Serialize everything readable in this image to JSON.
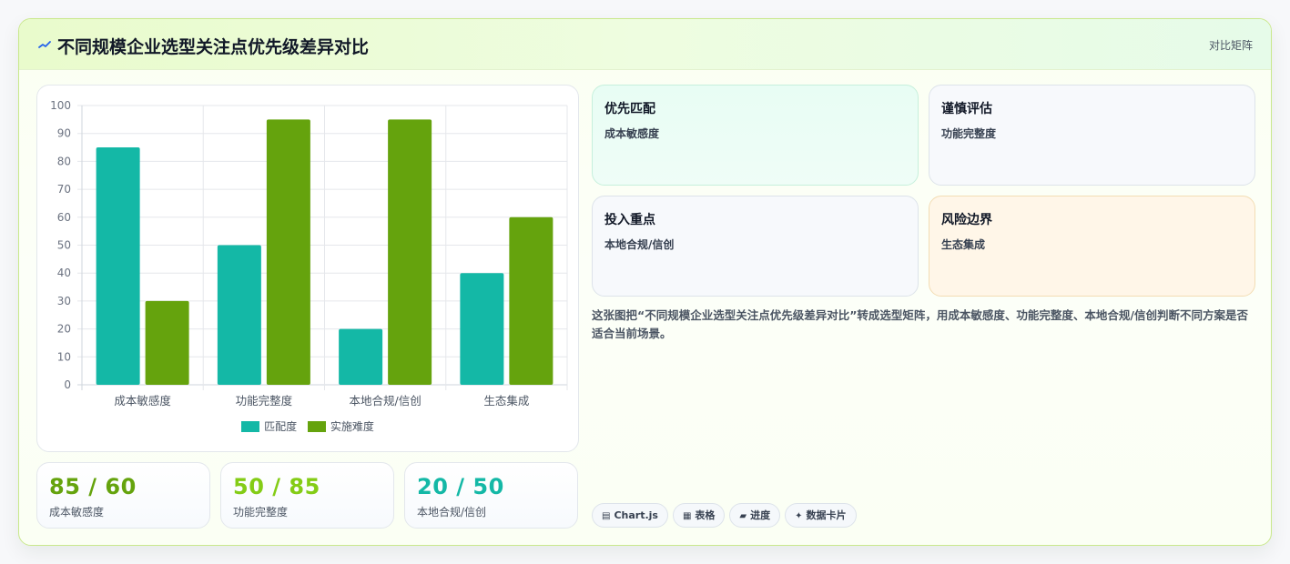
{
  "header": {
    "title": "不同规模企业选型关注点优先级差异对比",
    "tag": "对比矩阵"
  },
  "colors": {
    "series_a": "#14b8a6",
    "series_b": "#65a30d",
    "accent_dark": "#65a30d",
    "accent_light": "#84cc16",
    "accent_teal": "#14b8a6"
  },
  "chart_data": {
    "type": "bar",
    "categories": [
      "成本敏感度",
      "功能完整度",
      "本地合规/信创",
      "生态集成"
    ],
    "series": [
      {
        "name": "匹配度",
        "values": [
          85,
          50,
          20,
          40
        ]
      },
      {
        "name": "实施难度",
        "values": [
          30,
          95,
          95,
          60
        ]
      }
    ],
    "ylim": [
      0,
      100
    ],
    "yticks": [
      0,
      10,
      20,
      30,
      40,
      50,
      60,
      70,
      80,
      90,
      100
    ],
    "grid": true,
    "legend": "bottom"
  },
  "stats": [
    {
      "value": "85 / 60",
      "label": "成本敏感度"
    },
    {
      "value": "50 / 85",
      "label": "功能完整度"
    },
    {
      "value": "20 / 50",
      "label": "本地合规/信创"
    }
  ],
  "quadrants": [
    {
      "title": "优先匹配",
      "value": "成本敏感度"
    },
    {
      "title": "谨慎评估",
      "value": "功能完整度"
    },
    {
      "title": "投入重点",
      "value": "本地合规/信创"
    },
    {
      "title": "风险边界",
      "value": "生态集成"
    }
  ],
  "description": "这张图把“不同规模企业选型关注点优先级差异对比”转成选型矩阵，用成本敏感度、功能完整度、本地合规/信创判断不同方案是否适合当前场景。",
  "chips": [
    {
      "glyph": "▤",
      "label": "Chart.js"
    },
    {
      "glyph": "▦",
      "label": "表格"
    },
    {
      "glyph": "▰",
      "label": "进度"
    },
    {
      "glyph": "✦",
      "label": "数据卡片"
    }
  ]
}
